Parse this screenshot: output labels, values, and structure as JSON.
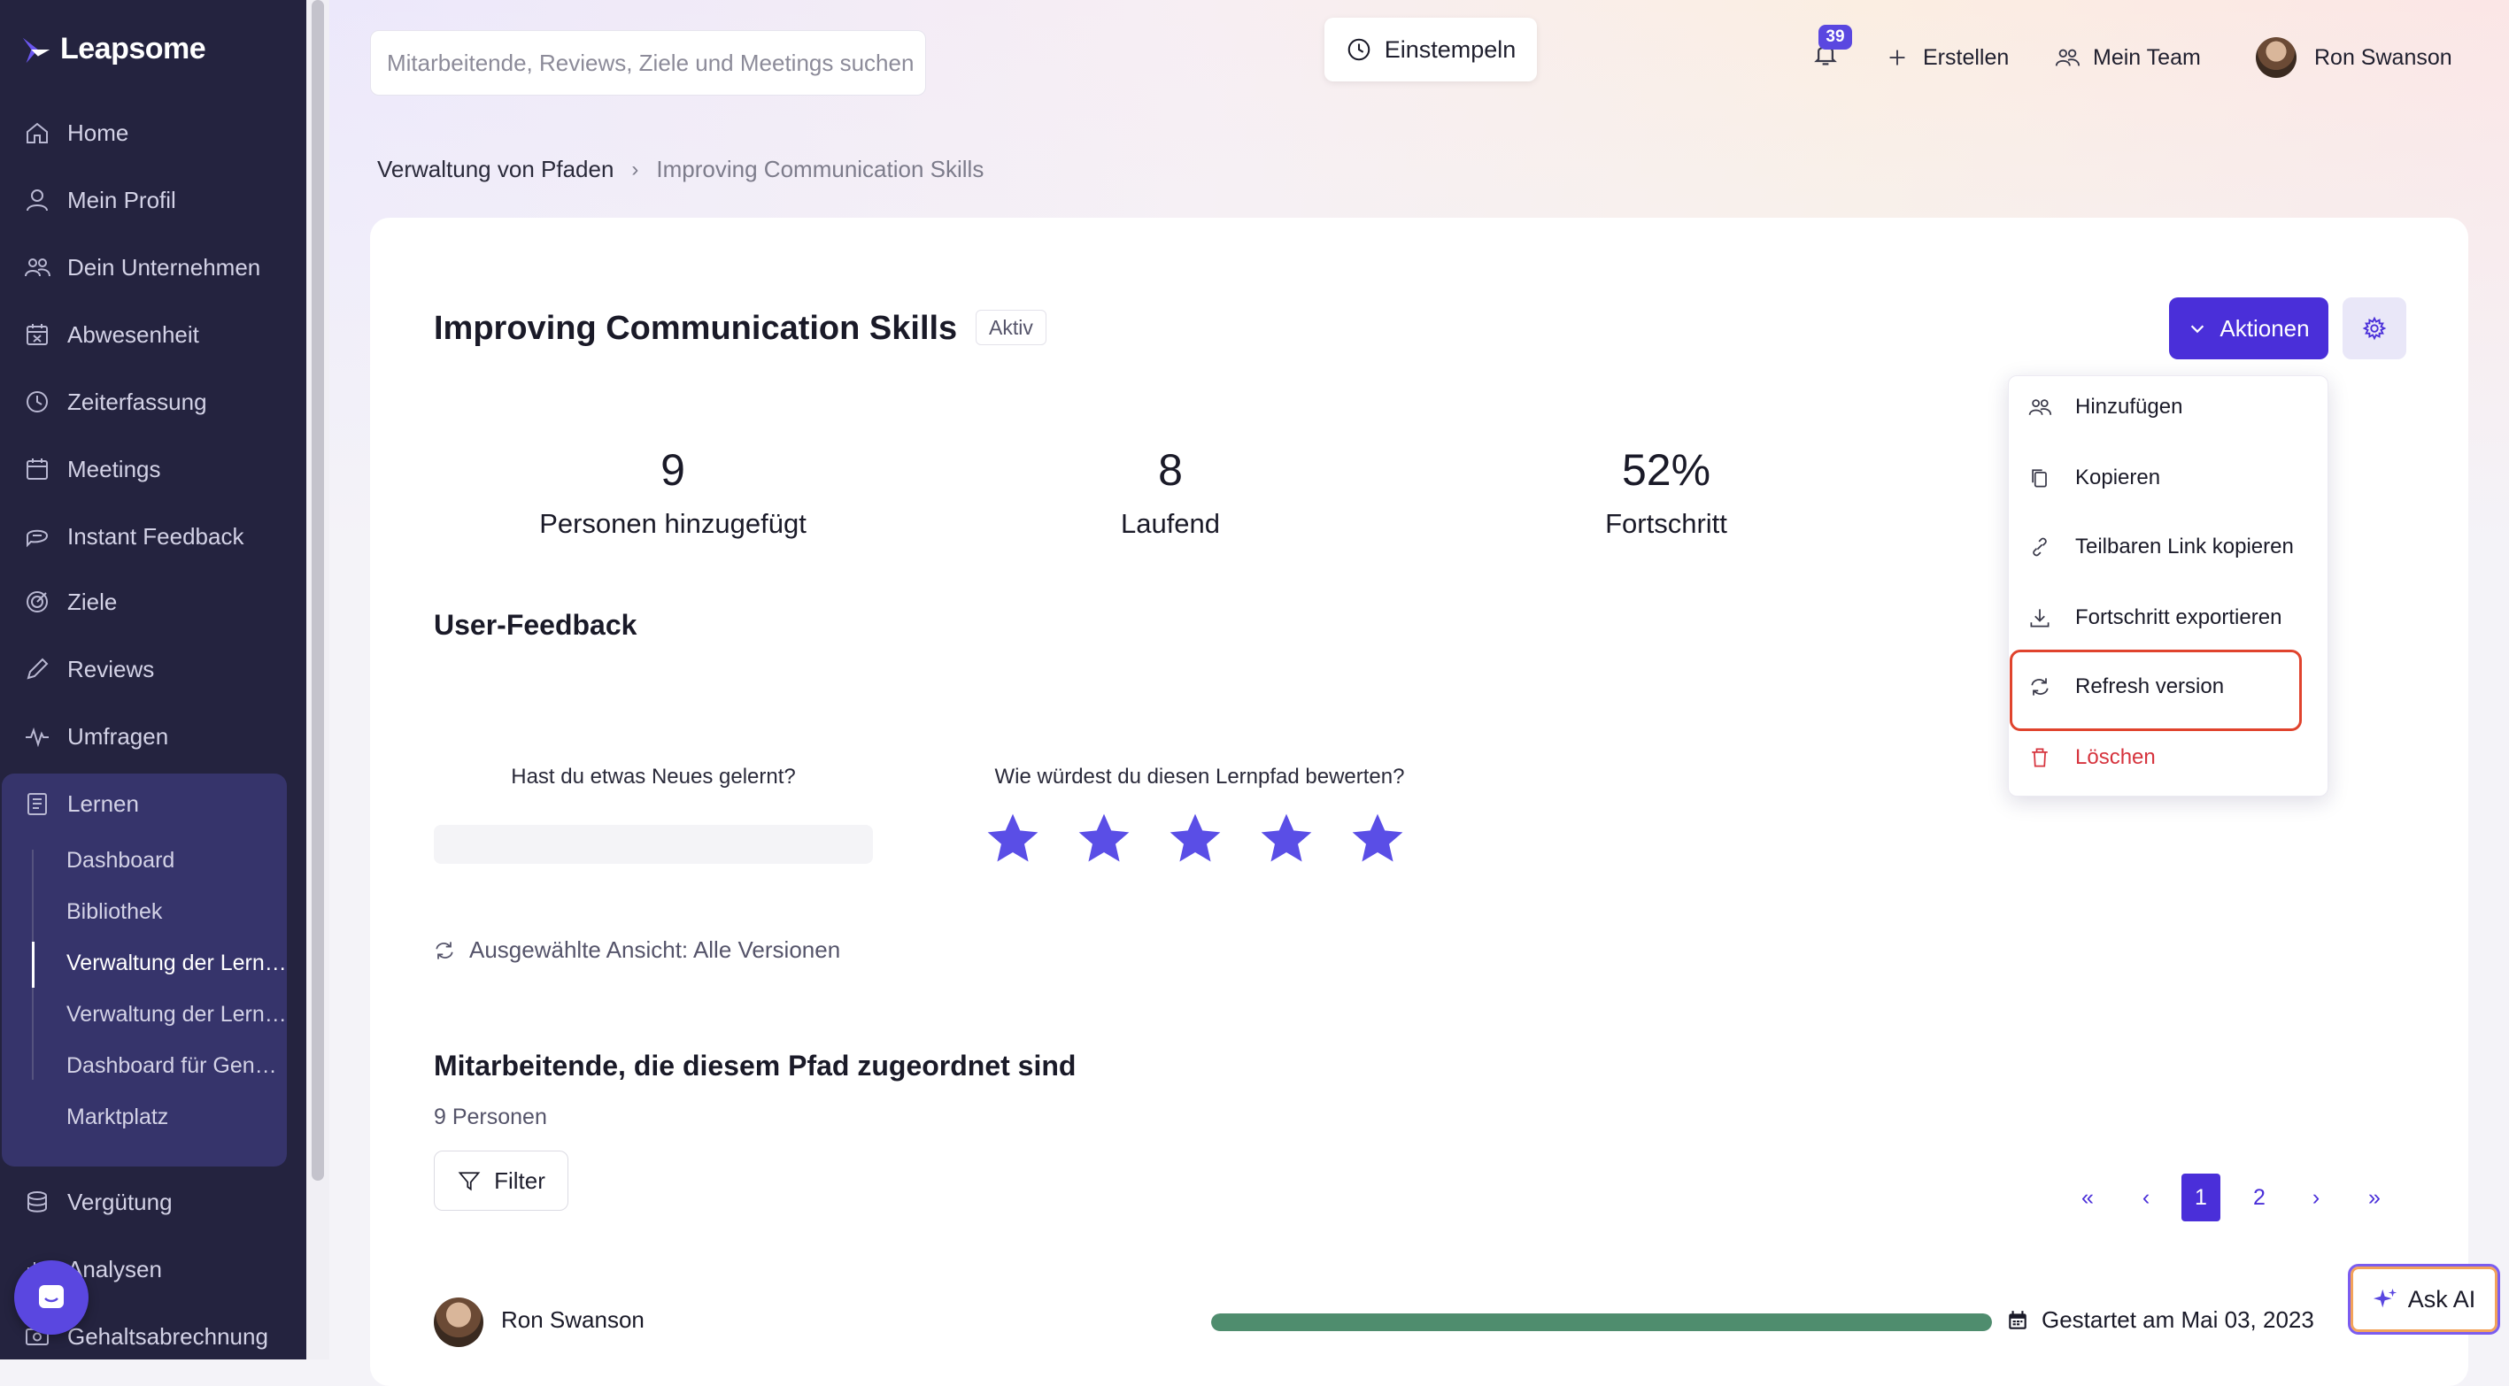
{
  "app": {
    "logo_text": "Leapsome"
  },
  "sidebar": {
    "items": [
      {
        "label": "Home",
        "icon": "home-icon"
      },
      {
        "label": "Mein Profil",
        "icon": "user-icon"
      },
      {
        "label": "Dein Unternehmen",
        "icon": "people-icon"
      },
      {
        "label": "Abwesenheit",
        "icon": "calendar-x-icon"
      },
      {
        "label": "Zeiterfassung",
        "icon": "clock-icon"
      },
      {
        "label": "Meetings",
        "icon": "calendar-icon"
      },
      {
        "label": "Instant Feedback",
        "icon": "chat-icon"
      },
      {
        "label": "Ziele",
        "icon": "target-icon"
      },
      {
        "label": "Reviews",
        "icon": "pencil-icon"
      },
      {
        "label": "Umfragen",
        "icon": "pulse-icon"
      },
      {
        "label": "Lernen",
        "icon": "book-icon"
      },
      {
        "label": "Vergütung",
        "icon": "coins-icon"
      },
      {
        "label": "Analysen",
        "icon": "chart-icon"
      },
      {
        "label": "Gehaltsabrechnung",
        "icon": "payroll-icon"
      }
    ],
    "lernen_sub": [
      {
        "label": "Dashboard"
      },
      {
        "label": "Bibliothek"
      },
      {
        "label": "Verwaltung der Lernpfade"
      },
      {
        "label": "Verwaltung der Lerninhalte"
      },
      {
        "label": "Dashboard für Genehmigungen"
      },
      {
        "label": "Marktplatz"
      }
    ]
  },
  "header": {
    "search_placeholder": "Mitarbeitende, Reviews, Ziele und Meetings suchen",
    "clock_in": "Einstempeln",
    "notifications_count": "39",
    "create": "Erstellen",
    "my_team": "Mein Team",
    "user_name": "Ron Swanson"
  },
  "breadcrumb": {
    "parent": "Verwaltung von Pfaden",
    "current": "Improving Communication Skills"
  },
  "path": {
    "title": "Improving Communication Skills",
    "status": "Aktiv",
    "actions_label": "Aktionen"
  },
  "stats": [
    {
      "value": "9",
      "label": "Personen hinzugefügt"
    },
    {
      "value": "8",
      "label": "Laufend"
    },
    {
      "value": "52%",
      "label": "Fortschritt"
    }
  ],
  "feedback": {
    "heading": "User-Feedback",
    "q1": "Hast du etwas Neues gelernt?",
    "q2": "Wie würdest du diesen Lernpfad bewerten?",
    "rating": 5,
    "rating_max": 5
  },
  "version_view": "Ausgewählte Ansicht: Alle Versionen",
  "employees": {
    "heading": "Mitarbeitende, die diesem Pfad zugeordnet sind",
    "count": "9 Personen",
    "filter_label": "Filter",
    "pager": [
      "«",
      "‹",
      "1",
      "2",
      "›",
      "»"
    ],
    "current_page": "1",
    "rows": [
      {
        "name": "Ron Swanson",
        "progress": 1.0,
        "started": "Gestartet am Mai 03, 2023"
      }
    ]
  },
  "dropdown": {
    "items": [
      {
        "label": "Hinzufügen",
        "icon": "people-add-icon"
      },
      {
        "label": "Kopieren",
        "icon": "copy-icon"
      },
      {
        "label": "Teilbaren Link kopieren",
        "icon": "link-icon"
      },
      {
        "label": "Fortschritt exportieren",
        "icon": "download-icon"
      },
      {
        "label": "Refresh version",
        "icon": "refresh-icon"
      },
      {
        "label": "Löschen",
        "icon": "trash-icon"
      }
    ]
  },
  "ask_ai": "Ask AI",
  "colors": {
    "accent": "#4a2fd9",
    "sidebar": "#24233f",
    "danger": "#d6333d",
    "progress": "#4f8d6e"
  }
}
